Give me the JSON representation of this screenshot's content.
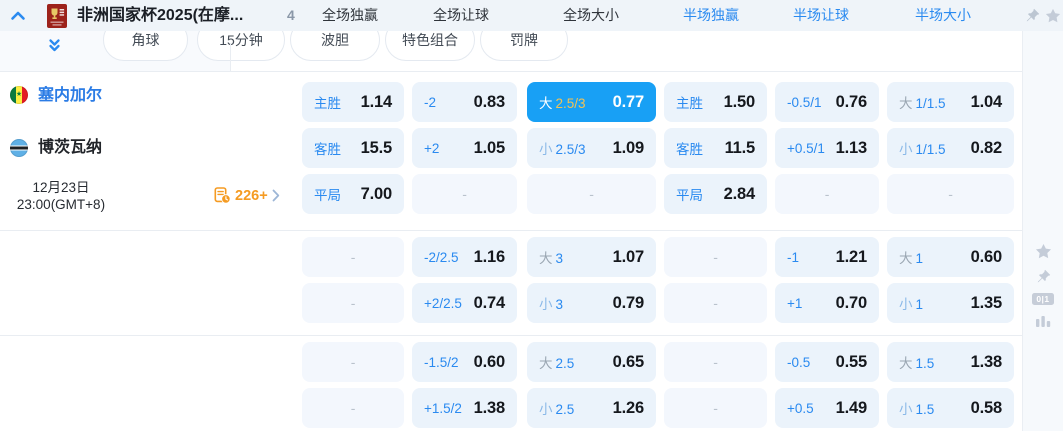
{
  "header": {
    "title": "非洲国家杯2025(在摩...",
    "count": "4",
    "markets": [
      {
        "label": "全场独赢",
        "active": false
      },
      {
        "label": "全场让球",
        "active": false
      },
      {
        "label": "全场大小",
        "active": false
      },
      {
        "label": "半场独赢",
        "active": true
      },
      {
        "label": "半场让球",
        "active": true
      },
      {
        "label": "半场大小",
        "active": true
      }
    ]
  },
  "toolbar": {
    "pills": [
      "角球",
      "15分钟",
      "波胆",
      "特色组合",
      "罚牌"
    ]
  },
  "match": {
    "home": {
      "name": "塞内加尔",
      "flag": "senegal-flag"
    },
    "away": {
      "name": "博茨瓦纳",
      "flag": "botswana-flag"
    },
    "date": "12月23日",
    "time": "23:00(GMT+8)",
    "more_count": "226+"
  },
  "right_rail": {
    "score_badge": "0|1",
    "icons": [
      "star-icon",
      "pin-icon",
      "score-badge",
      "stats-chart-icon"
    ]
  },
  "colors": {
    "accent_blue": "#2a8af0",
    "highlight_cell": "#18a0f5",
    "highlight_line_gold": "#f3c254",
    "orange": "#f59b22",
    "cell_bg": "#ebf3fb"
  },
  "odds_rows": [
    [
      {
        "kind": "outcome",
        "label": "主胜",
        "value": "1.14"
      },
      {
        "kind": "handicap",
        "label": "-2",
        "value": "0.83"
      },
      {
        "kind": "ou",
        "side": "大",
        "line": "2.5/3",
        "value": "0.77",
        "highlight": true
      },
      {
        "kind": "outcome",
        "label": "主胜",
        "value": "1.50"
      },
      {
        "kind": "handicap",
        "label": "-0.5/1",
        "value": "0.76"
      },
      {
        "kind": "ou",
        "side": "大",
        "line": "1/1.5",
        "value": "1.04"
      }
    ],
    [
      {
        "kind": "outcome",
        "label": "客胜",
        "value": "15.5"
      },
      {
        "kind": "handicap",
        "label": "+2",
        "value": "1.05"
      },
      {
        "kind": "ou",
        "side": "小",
        "line": "2.5/3",
        "value": "1.09"
      },
      {
        "kind": "outcome",
        "label": "客胜",
        "value": "11.5"
      },
      {
        "kind": "handicap",
        "label": "+0.5/1",
        "value": "1.13"
      },
      {
        "kind": "ou",
        "side": "小",
        "line": "1/1.5",
        "value": "0.82"
      }
    ],
    [
      {
        "kind": "outcome",
        "label": "平局",
        "value": "7.00"
      },
      {
        "kind": "dash",
        "value": "-"
      },
      {
        "kind": "dash",
        "value": "-"
      },
      {
        "kind": "outcome",
        "label": "平局",
        "value": "2.84"
      },
      {
        "kind": "dash",
        "value": "-"
      },
      {
        "kind": "dash",
        "value": "-"
      }
    ],
    [
      {
        "kind": "dash",
        "value": "-"
      },
      {
        "kind": "handicap",
        "label": "-2/2.5",
        "value": "1.16"
      },
      {
        "kind": "ou",
        "side": "大",
        "line": "3",
        "value": "1.07"
      },
      {
        "kind": "dash",
        "value": "-"
      },
      {
        "kind": "handicap",
        "label": "-1",
        "value": "1.21"
      },
      {
        "kind": "ou",
        "side": "大",
        "line": "1",
        "value": "0.60"
      }
    ],
    [
      {
        "kind": "dash",
        "value": "-"
      },
      {
        "kind": "handicap",
        "label": "+2/2.5",
        "value": "0.74"
      },
      {
        "kind": "ou",
        "side": "小",
        "line": "3",
        "value": "0.79"
      },
      {
        "kind": "dash",
        "value": "-"
      },
      {
        "kind": "handicap",
        "label": "+1",
        "value": "0.70"
      },
      {
        "kind": "ou",
        "side": "小",
        "line": "1",
        "value": "1.35"
      }
    ],
    [
      {
        "kind": "dash",
        "value": "-"
      },
      {
        "kind": "handicap",
        "label": "-1.5/2",
        "value": "0.60"
      },
      {
        "kind": "ou",
        "side": "大",
        "line": "2.5",
        "value": "0.65"
      },
      {
        "kind": "dash",
        "value": "-"
      },
      {
        "kind": "handicap",
        "label": "-0.5",
        "value": "0.55"
      },
      {
        "kind": "ou",
        "side": "大",
        "line": "1.5",
        "value": "1.38"
      }
    ],
    [
      {
        "kind": "dash",
        "value": "-"
      },
      {
        "kind": "handicap",
        "label": "+1.5/2",
        "value": "1.38"
      },
      {
        "kind": "ou",
        "side": "小",
        "line": "2.5",
        "value": "1.26"
      },
      {
        "kind": "dash",
        "value": "-"
      },
      {
        "kind": "handicap",
        "label": "+0.5",
        "value": "1.49"
      },
      {
        "kind": "ou",
        "side": "小",
        "line": "1.5",
        "value": "0.58"
      }
    ]
  ]
}
